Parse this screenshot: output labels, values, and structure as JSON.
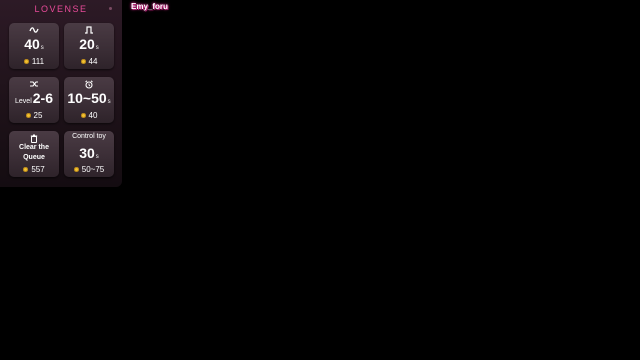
{
  "brand": "LOVENSE",
  "username": "Emy_foru",
  "cards": [
    {
      "icon": "wave-icon",
      "value": "40",
      "unit": "s",
      "tokens": "111"
    },
    {
      "icon": "pulse-icon",
      "value": "20",
      "unit": "s",
      "tokens": "44"
    },
    {
      "icon": "shuffle-icon",
      "prefix": "Level",
      "value": "2-6",
      "tokens": "25"
    },
    {
      "icon": "alarm-icon",
      "value": "10~50",
      "unit": "s",
      "tokens": "40"
    },
    {
      "icon": "trash-icon",
      "line1": "Clear the",
      "line2": "Queue",
      "tokens": "557"
    },
    {
      "label": "Control toy",
      "value": "30",
      "unit": "s",
      "tokens": "50~75"
    }
  ],
  "colors": {
    "brand": "#e94b9a",
    "coin": "#f2c230",
    "panel": "#2d1a26"
  }
}
